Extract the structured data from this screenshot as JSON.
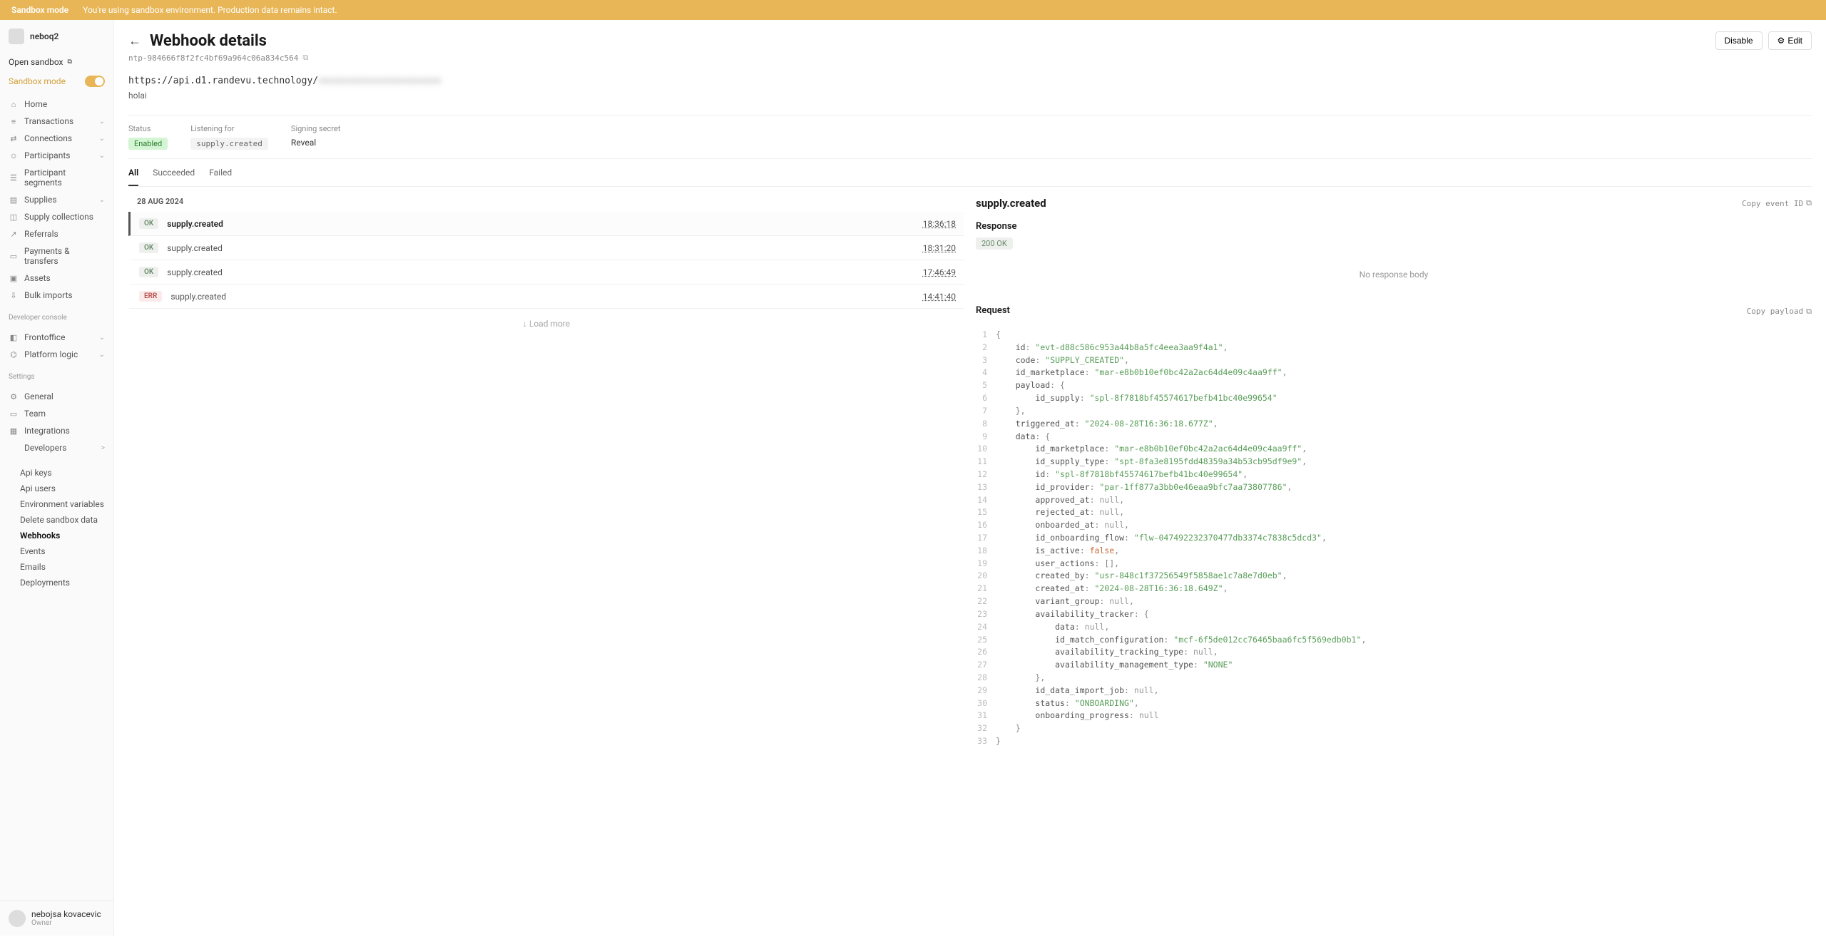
{
  "banner": {
    "label": "Sandbox mode",
    "text": "You're using sandbox environment. Production data remains intact."
  },
  "workspace": {
    "name": "neboq2"
  },
  "sidebar": {
    "open_sandbox": "Open sandbox",
    "sandbox_mode": "Sandbox mode",
    "nav": [
      {
        "icon": "home",
        "label": "Home"
      },
      {
        "icon": "transactions",
        "label": "Transactions",
        "chev": true
      },
      {
        "icon": "connections",
        "label": "Connections",
        "chev": true
      },
      {
        "icon": "participants",
        "label": "Participants",
        "chev": true
      },
      {
        "icon": "segments",
        "label": "Participant segments"
      },
      {
        "icon": "supplies",
        "label": "Supplies",
        "chev": true
      },
      {
        "icon": "collections",
        "label": "Supply collections"
      },
      {
        "icon": "referrals",
        "label": "Referrals"
      },
      {
        "icon": "payments",
        "label": "Payments & transfers"
      },
      {
        "icon": "assets",
        "label": "Assets"
      },
      {
        "icon": "imports",
        "label": "Bulk imports"
      }
    ],
    "heading_dev": "Developer console",
    "dev": [
      {
        "icon": "frontoffice",
        "label": "Frontoffice",
        "chev": true
      },
      {
        "icon": "logic",
        "label": "Platform logic",
        "chev": true
      }
    ],
    "heading_settings": "Settings",
    "settings": [
      {
        "icon": "general",
        "label": "General"
      },
      {
        "icon": "team",
        "label": "Team"
      },
      {
        "icon": "integrations",
        "label": "Integrations"
      },
      {
        "icon": "developers",
        "label": "Developers",
        "chev": ">"
      }
    ],
    "developers_sub": [
      "Api keys",
      "Api users",
      "Environment variables",
      "Delete sandbox data",
      "Webhooks",
      "Events",
      "Emails",
      "Deployments"
    ]
  },
  "user": {
    "name": "nebojsa kovacevic",
    "role": "Owner"
  },
  "page": {
    "title": "Webhook details",
    "id": "ntp-984666f8f2fc4bf69a964c06a834c564",
    "disable": "Disable",
    "edit": "Edit",
    "url_prefix": "https://api.d1.randevu.technology/",
    "url_blurred": "xxxxxxxxxxxxxxxxxxxxxx",
    "description": "holai",
    "status_label": "Status",
    "status_value": "Enabled",
    "listening_label": "Listening for",
    "listening_value": "supply.created",
    "secret_label": "Signing secret",
    "secret_action": "Reveal",
    "tabs": [
      "All",
      "Succeeded",
      "Failed"
    ],
    "date_group": "28 AUG 2024",
    "events": [
      {
        "status": "OK",
        "name": "supply.created",
        "time": "18:36:18",
        "selected": true
      },
      {
        "status": "OK",
        "name": "supply.created",
        "time": "18:31:20"
      },
      {
        "status": "OK",
        "name": "supply.created",
        "time": "17:46:49"
      },
      {
        "status": "ERR",
        "name": "supply.created",
        "time": "14:41:40"
      }
    ],
    "load_more": "Load more"
  },
  "detail": {
    "title": "supply.created",
    "copy_event": "Copy event ID",
    "response_label": "Response",
    "response_status": "200 OK",
    "no_body": "No response body",
    "request_label": "Request",
    "copy_payload": "Copy payload",
    "code": [
      [
        [
          "punc",
          "{"
        ]
      ],
      [
        [
          "pad",
          "    "
        ],
        [
          "key",
          "id"
        ],
        [
          "punc",
          ": "
        ],
        [
          "str",
          "\"evt-d88c586c953a44b8a5fc4eea3aa9f4a1\""
        ],
        [
          "punc",
          ","
        ]
      ],
      [
        [
          "pad",
          "    "
        ],
        [
          "key",
          "code"
        ],
        [
          "punc",
          ": "
        ],
        [
          "str",
          "\"SUPPLY_CREATED\""
        ],
        [
          "punc",
          ","
        ]
      ],
      [
        [
          "pad",
          "    "
        ],
        [
          "key",
          "id_marketplace"
        ],
        [
          "punc",
          ": "
        ],
        [
          "str",
          "\"mar-e8b0b10ef0bc42a2ac64d4e09c4aa9ff\""
        ],
        [
          "punc",
          ","
        ]
      ],
      [
        [
          "pad",
          "    "
        ],
        [
          "key",
          "payload"
        ],
        [
          "punc",
          ": {"
        ]
      ],
      [
        [
          "pad",
          "        "
        ],
        [
          "key",
          "id_supply"
        ],
        [
          "punc",
          ": "
        ],
        [
          "str",
          "\"spl-8f7818bf45574617befb41bc40e99654\""
        ]
      ],
      [
        [
          "pad",
          "    "
        ],
        [
          "punc",
          "},"
        ]
      ],
      [
        [
          "pad",
          "    "
        ],
        [
          "key",
          "triggered_at"
        ],
        [
          "punc",
          ": "
        ],
        [
          "str",
          "\"2024-08-28T16:36:18.677Z\""
        ],
        [
          "punc",
          ","
        ]
      ],
      [
        [
          "pad",
          "    "
        ],
        [
          "key",
          "data"
        ],
        [
          "punc",
          ": {"
        ]
      ],
      [
        [
          "pad",
          "        "
        ],
        [
          "key",
          "id_marketplace"
        ],
        [
          "punc",
          ": "
        ],
        [
          "str",
          "\"mar-e8b0b10ef0bc42a2ac64d4e09c4aa9ff\""
        ],
        [
          "punc",
          ","
        ]
      ],
      [
        [
          "pad",
          "        "
        ],
        [
          "key",
          "id_supply_type"
        ],
        [
          "punc",
          ": "
        ],
        [
          "str",
          "\"spt-8fa3e8195fdd48359a34b53cb95df9e9\""
        ],
        [
          "punc",
          ","
        ]
      ],
      [
        [
          "pad",
          "        "
        ],
        [
          "key",
          "id"
        ],
        [
          "punc",
          ": "
        ],
        [
          "str",
          "\"spl-8f7818bf45574617befb41bc40e99654\""
        ],
        [
          "punc",
          ","
        ]
      ],
      [
        [
          "pad",
          "        "
        ],
        [
          "key",
          "id_provider"
        ],
        [
          "punc",
          ": "
        ],
        [
          "str",
          "\"par-1ff877a3bb0e46eaa9bfc7aa73807786\""
        ],
        [
          "punc",
          ","
        ]
      ],
      [
        [
          "pad",
          "        "
        ],
        [
          "key",
          "approved_at"
        ],
        [
          "punc",
          ": "
        ],
        [
          "null",
          "null"
        ],
        [
          "punc",
          ","
        ]
      ],
      [
        [
          "pad",
          "        "
        ],
        [
          "key",
          "rejected_at"
        ],
        [
          "punc",
          ": "
        ],
        [
          "null",
          "null"
        ],
        [
          "punc",
          ","
        ]
      ],
      [
        [
          "pad",
          "        "
        ],
        [
          "key",
          "onboarded_at"
        ],
        [
          "punc",
          ": "
        ],
        [
          "null",
          "null"
        ],
        [
          "punc",
          ","
        ]
      ],
      [
        [
          "pad",
          "        "
        ],
        [
          "key",
          "id_onboarding_flow"
        ],
        [
          "punc",
          ": "
        ],
        [
          "str",
          "\"flw-047492232370477db3374c7838c5dcd3\""
        ],
        [
          "punc",
          ","
        ]
      ],
      [
        [
          "pad",
          "        "
        ],
        [
          "key",
          "is_active"
        ],
        [
          "punc",
          ": "
        ],
        [
          "bool",
          "false"
        ],
        [
          "punc",
          ","
        ]
      ],
      [
        [
          "pad",
          "        "
        ],
        [
          "key",
          "user_actions"
        ],
        [
          "punc",
          ": [],"
        ]
      ],
      [
        [
          "pad",
          "        "
        ],
        [
          "key",
          "created_by"
        ],
        [
          "punc",
          ": "
        ],
        [
          "str",
          "\"usr-848c1f37256549f5858ae1c7a8e7d0eb\""
        ],
        [
          "punc",
          ","
        ]
      ],
      [
        [
          "pad",
          "        "
        ],
        [
          "key",
          "created_at"
        ],
        [
          "punc",
          ": "
        ],
        [
          "str",
          "\"2024-08-28T16:36:18.649Z\""
        ],
        [
          "punc",
          ","
        ]
      ],
      [
        [
          "pad",
          "        "
        ],
        [
          "key",
          "variant_group"
        ],
        [
          "punc",
          ": "
        ],
        [
          "null",
          "null"
        ],
        [
          "punc",
          ","
        ]
      ],
      [
        [
          "pad",
          "        "
        ],
        [
          "key",
          "availability_tracker"
        ],
        [
          "punc",
          ": {"
        ]
      ],
      [
        [
          "pad",
          "            "
        ],
        [
          "key",
          "data"
        ],
        [
          "punc",
          ": "
        ],
        [
          "null",
          "null"
        ],
        [
          "punc",
          ","
        ]
      ],
      [
        [
          "pad",
          "            "
        ],
        [
          "key",
          "id_match_configuration"
        ],
        [
          "punc",
          ": "
        ],
        [
          "str",
          "\"mcf-6f5de012cc76465baa6fc5f569edb0b1\""
        ],
        [
          "punc",
          ","
        ]
      ],
      [
        [
          "pad",
          "            "
        ],
        [
          "key",
          "availability_tracking_type"
        ],
        [
          "punc",
          ": "
        ],
        [
          "null",
          "null"
        ],
        [
          "punc",
          ","
        ]
      ],
      [
        [
          "pad",
          "            "
        ],
        [
          "key",
          "availability_management_type"
        ],
        [
          "punc",
          ": "
        ],
        [
          "str",
          "\"NONE\""
        ]
      ],
      [
        [
          "pad",
          "        "
        ],
        [
          "punc",
          "},"
        ]
      ],
      [
        [
          "pad",
          "        "
        ],
        [
          "key",
          "id_data_import_job"
        ],
        [
          "punc",
          ": "
        ],
        [
          "null",
          "null"
        ],
        [
          "punc",
          ","
        ]
      ],
      [
        [
          "pad",
          "        "
        ],
        [
          "key",
          "status"
        ],
        [
          "punc",
          ": "
        ],
        [
          "str",
          "\"ONBOARDING\""
        ],
        [
          "punc",
          ","
        ]
      ],
      [
        [
          "pad",
          "        "
        ],
        [
          "key",
          "onboarding_progress"
        ],
        [
          "punc",
          ": "
        ],
        [
          "null",
          "null"
        ]
      ],
      [
        [
          "pad",
          "    "
        ],
        [
          "punc",
          "}"
        ]
      ],
      [
        [
          "punc",
          "}"
        ]
      ]
    ]
  }
}
